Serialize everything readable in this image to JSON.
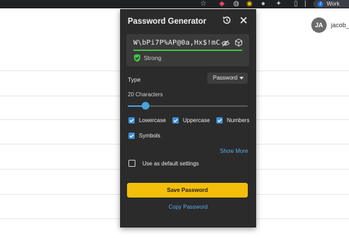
{
  "browser": {
    "profile_label": "Work",
    "profile_initial": "J"
  },
  "page": {
    "avatar_initials": "JA",
    "username": "jacob_"
  },
  "popup": {
    "title": "Password Generator",
    "password": "W\\bPi7P%AP@0a,Hx$!mC",
    "strength_label": "Strong",
    "strength_fraction": 1.0,
    "type_label": "Type",
    "type_value": "Password",
    "characters_label": "20 Characters",
    "length_slider_fraction": 0.15,
    "options": {
      "lowercase": {
        "label": "Lowercase",
        "checked": true
      },
      "uppercase": {
        "label": "Uppercase",
        "checked": true
      },
      "numbers": {
        "label": "Numbers",
        "checked": true
      },
      "symbols": {
        "label": "Symbols",
        "checked": true
      }
    },
    "show_more_label": "Show More",
    "default_settings_label": "Use as default settings",
    "default_settings_checked": false,
    "save_label": "Save Password",
    "copy_label": "Copy Password"
  },
  "colors": {
    "accent_yellow": "#f5be0b",
    "link_blue": "#5aa9e6",
    "strength_green": "#42c14a",
    "checkbox_blue": "#3b8fd6"
  }
}
